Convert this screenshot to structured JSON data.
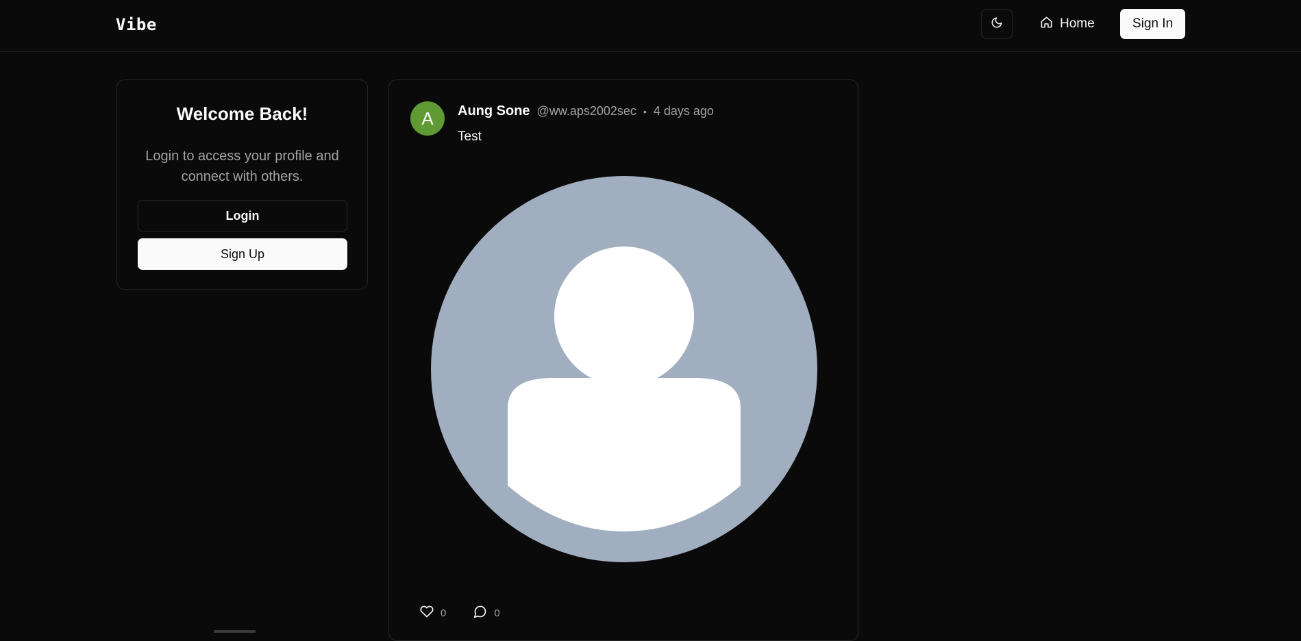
{
  "header": {
    "logo": "Vibe",
    "theme_toggle_icon": "moon-icon",
    "home_label": "Home",
    "home_icon": "home-icon",
    "signin_label": "Sign In"
  },
  "welcome": {
    "title": "Welcome Back!",
    "text": "Login to access your profile and connect with others.",
    "login_label": "Login",
    "signup_label": "Sign Up"
  },
  "post": {
    "avatar_letter": "A",
    "avatar_color": "#5f9a35",
    "author_name": "Aung Sone",
    "handle": "@ww.aps2002sec",
    "separator": "•",
    "time": "4 days ago",
    "text": "Test",
    "image": "default-profile-placeholder",
    "likes": "0",
    "comments": "0"
  },
  "colors": {
    "background": "#0a0a0a",
    "border": "#262626",
    "primary_button": "#fafafa",
    "muted_text": "#a3a3a3",
    "placeholder_bg": "#a1aec0"
  }
}
